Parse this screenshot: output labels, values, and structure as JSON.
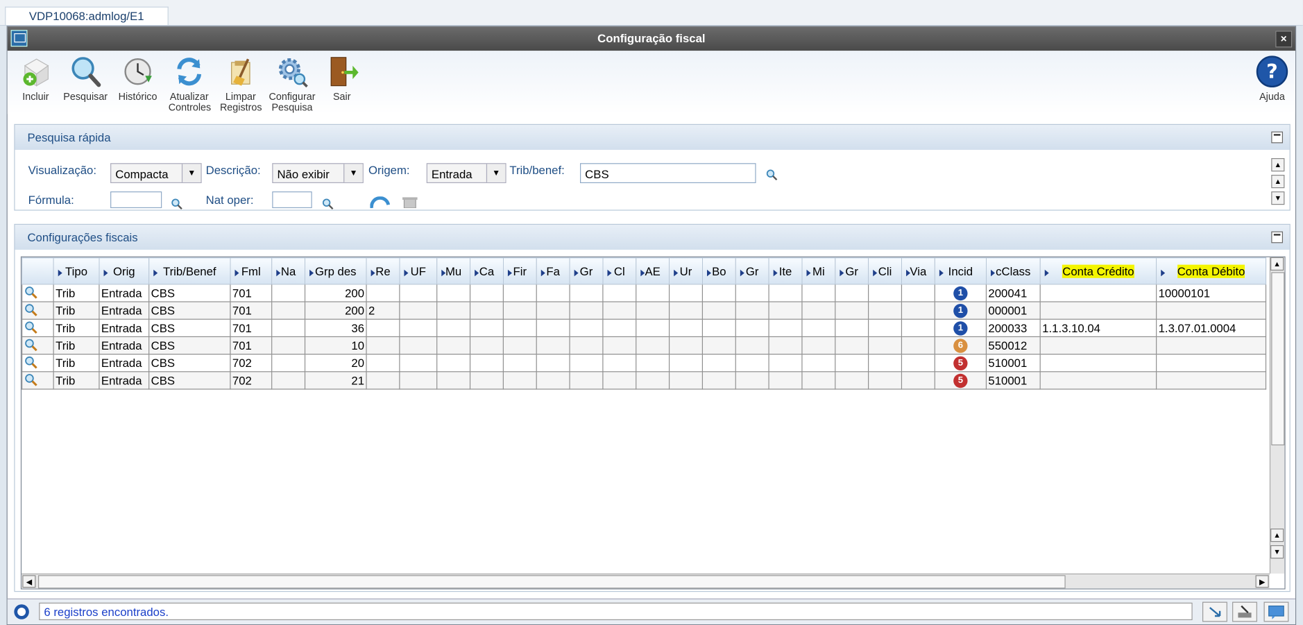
{
  "tab": {
    "label": "VDP10068:admlog/E1"
  },
  "window": {
    "title": "Configuração fiscal",
    "close_label": "×"
  },
  "toolbar": {
    "items": [
      {
        "label": "Incluir",
        "icon": "add-document-icon"
      },
      {
        "label": "Pesquisar",
        "icon": "magnifier-icon"
      },
      {
        "label": "Histórico",
        "icon": "history-icon"
      },
      {
        "label": "Atualizar Controles",
        "icon": "refresh-icon"
      },
      {
        "label": "Limpar Registros",
        "icon": "broom-icon"
      },
      {
        "label": "Configurar Pesquisa",
        "icon": "gear-search-icon"
      },
      {
        "label": "Sair",
        "icon": "exit-door-icon"
      }
    ],
    "help_label": "Ajuda"
  },
  "quick_search": {
    "title": "Pesquisa rápida",
    "visualizacao_label": "Visualização:",
    "visualizacao_value": "Compacta",
    "descricao_label": "Descrição:",
    "descricao_value": "Não exibir",
    "origem_label": "Origem:",
    "origem_value": "Entrada",
    "trib_label": "Trib/benef:",
    "trib_value": "CBS",
    "formula_label": "Fórmula:",
    "formula_value": "",
    "nat_oper_label": "Nat oper:",
    "nat_oper_value": ""
  },
  "grid_panel": {
    "title": "Configurações fiscais",
    "columns": [
      "Tipo",
      "Orig",
      "Trib/Benef",
      "Fml",
      "Na",
      "Grp des",
      "Re",
      "UF",
      "Mu",
      "Ca",
      "Fir",
      "Fa",
      "Gr",
      "Cl",
      "AE",
      "Ur",
      "Bo",
      "Gr",
      "Ite",
      "Mi",
      "Gr",
      "Cli",
      "Via",
      "Incid",
      "cClass",
      "Conta Crédito",
      "Conta Débito"
    ],
    "rows": [
      {
        "tipo": "Trib",
        "orig": "Entrada",
        "trib": "CBS",
        "fml": "701",
        "grp": "200",
        "re": "",
        "incid": "1",
        "cclass": "200041",
        "credito": "",
        "debito": "10000101"
      },
      {
        "tipo": "Trib",
        "orig": "Entrada",
        "trib": "CBS",
        "fml": "701",
        "grp": "200",
        "re": "2",
        "incid": "1",
        "cclass": "000001",
        "credito": "",
        "debito": ""
      },
      {
        "tipo": "Trib",
        "orig": "Entrada",
        "trib": "CBS",
        "fml": "701",
        "grp": "36",
        "re": "",
        "incid": "1",
        "cclass": "200033",
        "credito": "1.1.3.10.04",
        "debito": "1.3.07.01.0004"
      },
      {
        "tipo": "Trib",
        "orig": "Entrada",
        "trib": "CBS",
        "fml": "701",
        "grp": "10",
        "re": "",
        "incid": "6",
        "cclass": "550012",
        "credito": "",
        "debito": ""
      },
      {
        "tipo": "Trib",
        "orig": "Entrada",
        "trib": "CBS",
        "fml": "702",
        "grp": "20",
        "re": "",
        "incid": "5",
        "cclass": "510001",
        "credito": "",
        "debito": ""
      },
      {
        "tipo": "Trib",
        "orig": "Entrada",
        "trib": "CBS",
        "fml": "702",
        "grp": "21",
        "re": "",
        "incid": "5",
        "cclass": "510001",
        "credito": "",
        "debito": ""
      }
    ],
    "badge_colors": {
      "1": "#1f4fa8",
      "5": "#c23030",
      "6": "#d99040"
    }
  },
  "status": {
    "text": "6 registros encontrados."
  }
}
